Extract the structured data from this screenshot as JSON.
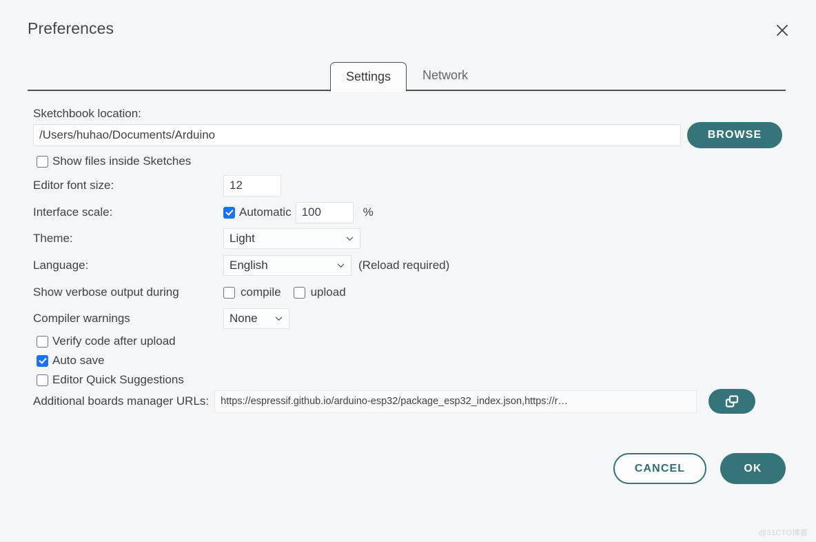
{
  "window": {
    "title": "Preferences",
    "close_icon": "close-icon",
    "watermark": "@51CTO博客"
  },
  "tabs": [
    {
      "label": "Settings",
      "active": true
    },
    {
      "label": "Network",
      "active": false
    }
  ],
  "settings": {
    "sketchbook": {
      "label": "Sketchbook location:",
      "value": "/Users/huhao/Documents/Arduino",
      "browse_label": "BROWSE"
    },
    "show_files_inside_sketches": {
      "label": "Show files inside Sketches",
      "checked": false
    },
    "editor_font_size": {
      "label": "Editor font size:",
      "value": "12"
    },
    "interface_scale": {
      "label": "Interface scale:",
      "automatic_label": "Automatic",
      "automatic_checked": true,
      "value": "100",
      "unit": "%"
    },
    "theme": {
      "label": "Theme:",
      "value": "Light",
      "options": [
        "Light"
      ]
    },
    "language": {
      "label": "Language:",
      "value": "English",
      "options": [
        "English"
      ],
      "note": "(Reload required)"
    },
    "verbose_output": {
      "label": "Show verbose output during",
      "compile_label": "compile",
      "compile_checked": false,
      "upload_label": "upload",
      "upload_checked": false
    },
    "compiler_warnings": {
      "label": "Compiler warnings",
      "value": "None",
      "options": [
        "None"
      ]
    },
    "verify_code_after_upload": {
      "label": "Verify code after upload",
      "checked": false
    },
    "auto_save": {
      "label": "Auto save",
      "checked": true
    },
    "editor_quick_suggestions": {
      "label": "Editor Quick Suggestions",
      "checked": false
    },
    "boards_urls": {
      "label": "Additional boards manager URLs:",
      "value": "https://espressif.github.io/arduino-esp32/package_esp32_index.json,https://r…",
      "expand_icon": "open-in-window-icon"
    }
  },
  "footer": {
    "cancel_label": "CANCEL",
    "ok_label": "OK"
  },
  "colors": {
    "accent_teal": "#35757a",
    "checkbox_blue": "#1a73f0",
    "background": "#f5f6f7",
    "text": "#3c4247"
  }
}
